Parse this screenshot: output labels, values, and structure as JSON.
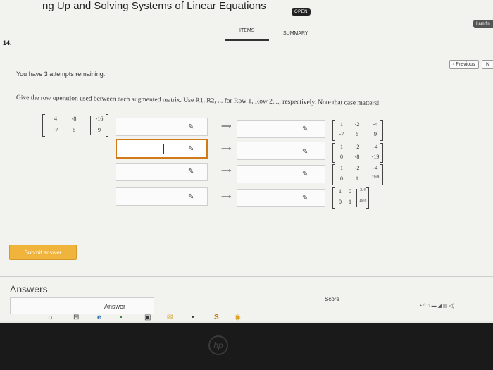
{
  "header": {
    "title": "ng Up and Solving Systems of Linear Equations",
    "badge": "OPEN",
    "right_button": "I am fin",
    "tabs": [
      {
        "label": "ITEMS"
      },
      {
        "label": "SUMMARY"
      }
    ]
  },
  "question": {
    "number": "14.",
    "prev": "‹ Previous",
    "next": "N",
    "attempts": "You have 3 attempts remaining.",
    "instruction": "Give the row operation used between each augmented matrix. Use R1, R2, ... for Row 1, Row 2,..., respectively. Note that case matters!"
  },
  "matrices": {
    "start": {
      "r1": [
        "4",
        "-8",
        "-16"
      ],
      "r2": [
        "-7",
        "6",
        "9"
      ]
    },
    "m1": {
      "r1": [
        "1",
        "-2",
        "-4"
      ],
      "r2": [
        "-7",
        "6",
        "9"
      ]
    },
    "m2": {
      "r1": [
        "1",
        "-2",
        "-4"
      ],
      "r2": [
        "0",
        "-8",
        "-19"
      ]
    },
    "m3": {
      "r1": [
        "1",
        "-2",
        "-4"
      ],
      "r2": [
        "0",
        "1",
        "19/8"
      ]
    },
    "m4": {
      "r1": [
        "1",
        "0",
        "3/4"
      ],
      "r2": [
        "0",
        "1",
        "19/8"
      ]
    }
  },
  "icons": {
    "pencil": "✎",
    "arrow": "⟶"
  },
  "buttons": {
    "submit": "Submit answer"
  },
  "answers": {
    "heading": "Answers",
    "answer_col": "Answer",
    "score_col": "Score"
  },
  "taskbar": {
    "icons": [
      "circle-icon",
      "task-view-icon",
      "edge-icon",
      "store-icon",
      "lock-icon",
      "mail-icon",
      "dot-icon",
      "s-app-icon",
      "chrome-icon"
    ]
  },
  "bezel": {
    "logo": "hp"
  }
}
